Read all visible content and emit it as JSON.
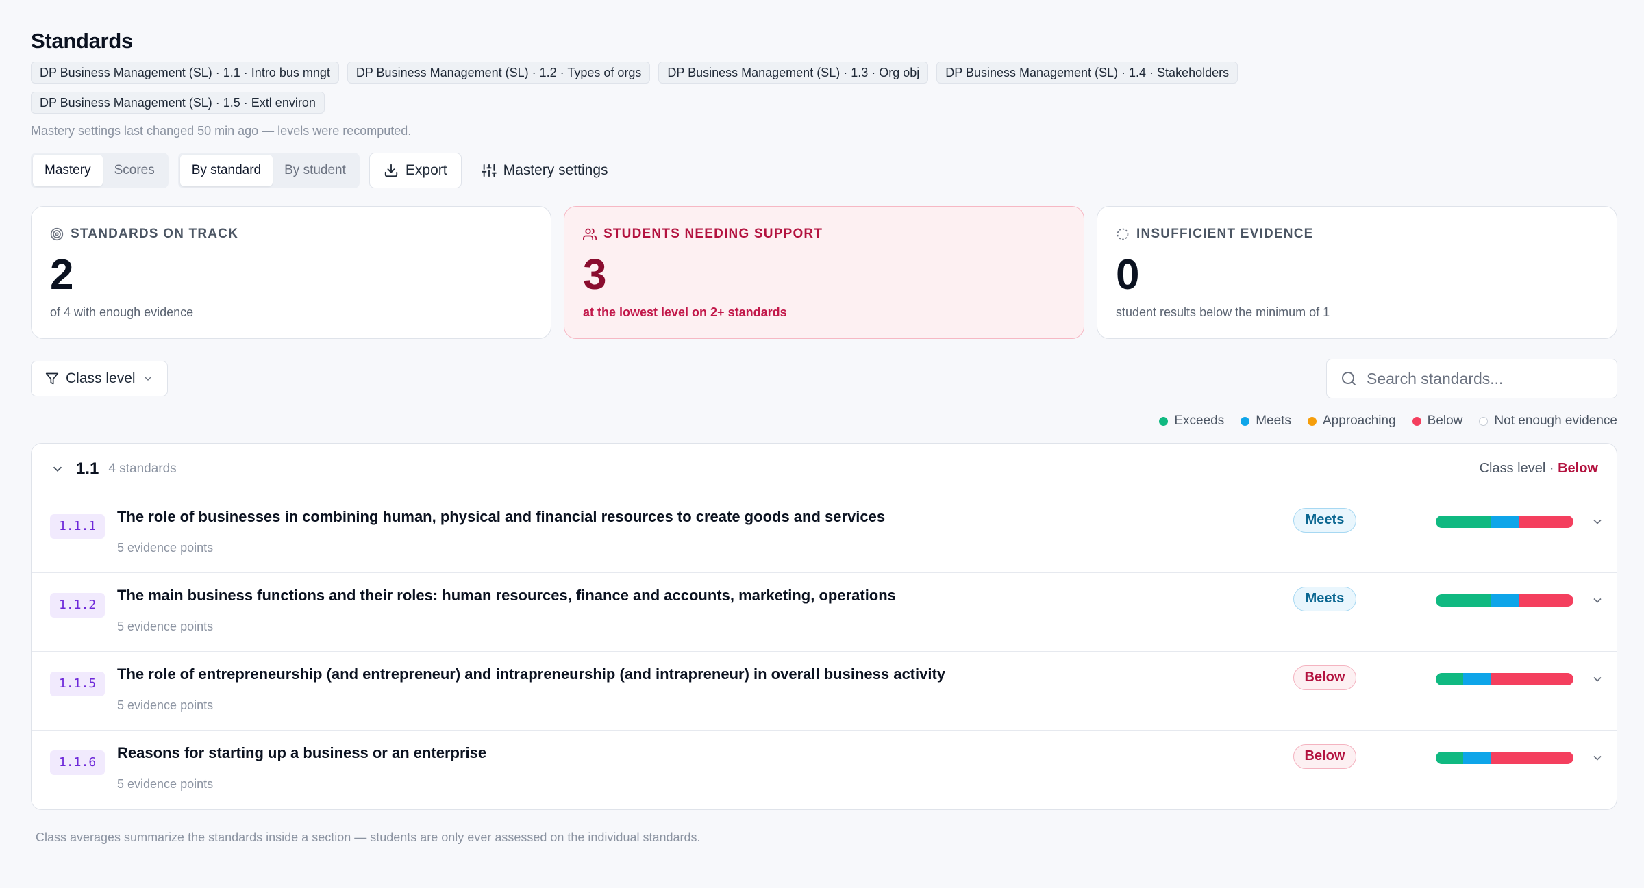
{
  "page": {
    "title": "Standards"
  },
  "courses": [
    "DP Business Management (SL) · 1.1 · Intro bus mngt",
    "DP Business Management (SL) · 1.2 · Types of orgs",
    "DP Business Management (SL) · 1.3 · Org obj",
    "DP Business Management (SL) · 1.4 · Stakeholders",
    "DP Business Management (SL) · 1.5 · Extl environ"
  ],
  "recompute_note": "Mastery settings last changed 50 min ago — levels were recomputed.",
  "toolbar": {
    "view_mode": {
      "options": [
        "Mastery",
        "Scores"
      ],
      "selected": "Mastery"
    },
    "grouping": {
      "options": [
        "By standard",
        "By student"
      ],
      "selected": "By standard"
    },
    "export_label": "Export",
    "settings_label": "Mastery settings"
  },
  "summary": {
    "on_track": {
      "label": "STANDARDS ON TRACK",
      "value": "2",
      "sub": "of 4 with enough evidence"
    },
    "support": {
      "label": "STUDENTS NEEDING SUPPORT",
      "value": "3",
      "sub": "at the lowest level on 2+ standards"
    },
    "insufficient": {
      "label": "INSUFFICIENT EVIDENCE",
      "value": "0",
      "sub": "student results below the minimum of 1"
    }
  },
  "filter": {
    "label": "Class level"
  },
  "search": {
    "placeholder": "Search standards..."
  },
  "legend": [
    {
      "label": "Exceeds",
      "color": "#10b981"
    },
    {
      "label": "Meets",
      "color": "#0ea5e9"
    },
    {
      "label": "Approaching",
      "color": "#f59e0b"
    },
    {
      "label": "Below",
      "color": "#f43f5e"
    },
    {
      "label": "Not enough evidence",
      "color": "#ffffff"
    }
  ],
  "group": {
    "code": "1.1",
    "count": "4 standards",
    "class_level_label": "Class level ·",
    "class_level_value": "Below",
    "standards": [
      {
        "code": "1.1.1",
        "title": "The role of businesses in combining human, physical and financial resources to create goods and services",
        "evidence": "5 evidence points",
        "status": "Meets",
        "distribution": {
          "exceeds": 0.4,
          "meets": 0.2,
          "approaching": 0,
          "below": 0.4
        }
      },
      {
        "code": "1.1.2",
        "title": "The main business functions and their roles: human resources, finance and accounts, marketing, operations",
        "evidence": "5 evidence points",
        "status": "Meets",
        "distribution": {
          "exceeds": 0.4,
          "meets": 0.2,
          "approaching": 0,
          "below": 0.4
        }
      },
      {
        "code": "1.1.5",
        "title": "The role of entrepreneurship (and entrepreneur) and intrapreneurship (and intrapreneur) in overall business activity",
        "evidence": "5 evidence points",
        "status": "Below",
        "distribution": {
          "exceeds": 0.2,
          "meets": 0.2,
          "approaching": 0,
          "below": 0.6
        }
      },
      {
        "code": "1.1.6",
        "title": "Reasons for starting up a business or an enterprise",
        "evidence": "5 evidence points",
        "status": "Below",
        "distribution": {
          "exceeds": 0.2,
          "meets": 0.2,
          "approaching": 0,
          "below": 0.6
        }
      }
    ]
  },
  "footnote": "Class averages summarize the standards inside a section — students are only ever assessed on the individual standards."
}
